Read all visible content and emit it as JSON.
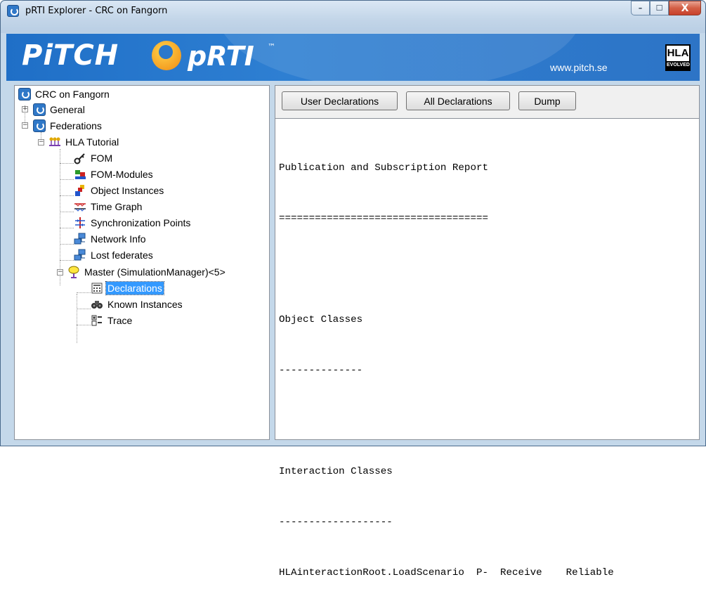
{
  "window": {
    "title": "pRTI Explorer - CRC on Fangorn",
    "minimize_glyph": "–",
    "maximize_glyph": "☐",
    "close_glyph": "X"
  },
  "banner": {
    "logo_text": "PiTCH",
    "product_text": "pRTI",
    "trademark": "™",
    "url": "www.pitch.se",
    "hla_top": "HLA",
    "hla_bottom": "EVOLVED"
  },
  "tree": {
    "root": "CRC on Fangorn",
    "general": "General",
    "federations": "Federations",
    "hla_tutorial": "HLA Tutorial",
    "fom": "FOM",
    "fom_modules": "FOM-Modules",
    "object_instances": "Object Instances",
    "time_graph": "Time Graph",
    "sync_points": "Synchronization Points",
    "network_info": "Network Info",
    "lost_federates": "Lost federates",
    "master": "Master (SimulationManager)<5>",
    "declarations": "Declarations",
    "known_instances": "Known Instances",
    "trace": "Trace"
  },
  "toolbar": {
    "user_declarations": "User Declarations",
    "all_declarations": "All Declarations",
    "dump": "Dump"
  },
  "report": {
    "lines": [
      "Publication and Subscription Report",
      "===================================",
      "",
      "Object Classes",
      "--------------",
      "",
      "Interaction Classes",
      "-------------------",
      "HLAinteractionRoot.LoadScenario  P-  Receive    Reliable"
    ]
  },
  "colors": {
    "banner": "#2e7fd2",
    "selection": "#3399ff"
  }
}
